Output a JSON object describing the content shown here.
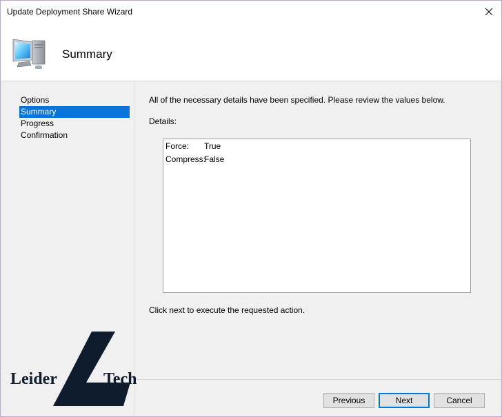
{
  "window": {
    "title": "Update Deployment Share Wizard"
  },
  "header": {
    "title": "Summary",
    "icon": "computer-icon"
  },
  "nav": {
    "items": [
      {
        "label": "Options",
        "selected": false
      },
      {
        "label": "Summary",
        "selected": true
      },
      {
        "label": "Progress",
        "selected": false
      },
      {
        "label": "Confirmation",
        "selected": false
      }
    ]
  },
  "main": {
    "intro": "All of the necessary details have been specified.  Please review the values below.",
    "details_label": "Details:",
    "details": [
      {
        "key": "Force:",
        "value": "True"
      },
      {
        "key": "Compress:",
        "value": "False"
      }
    ],
    "footer": "Click next to execute the requested action."
  },
  "buttons": {
    "previous": "Previous",
    "next": "Next",
    "cancel": "Cancel"
  },
  "watermark": {
    "left": "Leider",
    "right": "Tech"
  },
  "colors": {
    "selection": "#0a74d8",
    "logo": "#0f1c2e",
    "default_button_border": "#0078d7"
  }
}
